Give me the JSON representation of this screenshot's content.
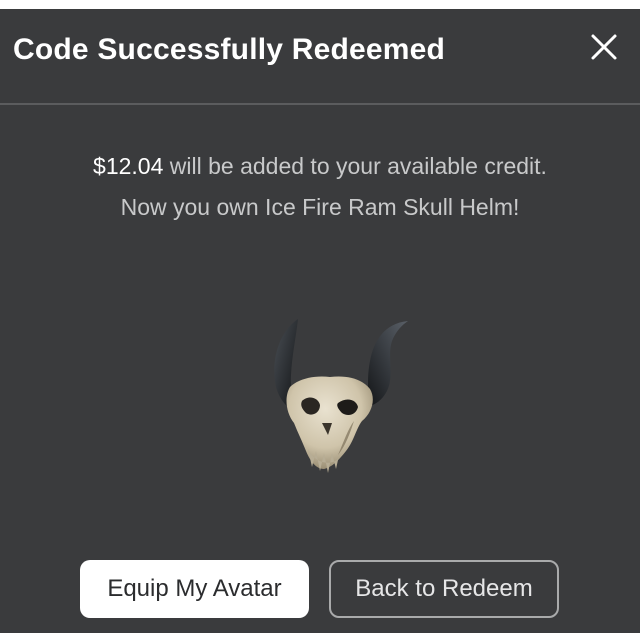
{
  "modal": {
    "title": "Code Successfully Redeemed",
    "close_icon": "close-x-icon"
  },
  "message": {
    "amount": "$12.04",
    "line1_rest": " will be added to your available credit.",
    "line2": "Now you own Ice Fire Ram Skull Helm!"
  },
  "item": {
    "image_icon": "ram-skull-helm-image"
  },
  "buttons": {
    "equip_label": "Equip My Avatar",
    "back_label": "Back to Redeem"
  },
  "colors": {
    "modal_background": "#3a3b3d",
    "primary_button": "#ffffff",
    "secondary_border": "#a9aaab",
    "muted_text": "#c8c9ca"
  }
}
